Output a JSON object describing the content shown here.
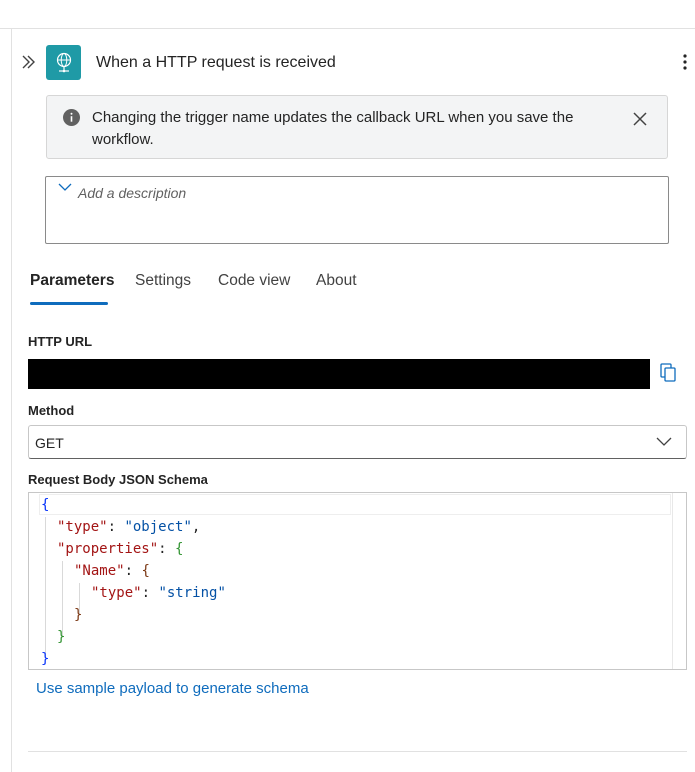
{
  "header": {
    "title": "When a HTTP request is received",
    "icon": "globe-network-icon",
    "accent_color": "#1f9aa6"
  },
  "info_bar": {
    "message": "Changing the trigger name updates the callback URL when you save the workflow."
  },
  "description": {
    "placeholder": "Add a description"
  },
  "tabs": [
    {
      "label": "Parameters",
      "active": true
    },
    {
      "label": "Settings",
      "active": false
    },
    {
      "label": "Code view",
      "active": false
    },
    {
      "label": "About",
      "active": false
    }
  ],
  "fields": {
    "http_url_label": "HTTP URL",
    "http_url_value": "",
    "method_label": "Method",
    "method_value": "GET",
    "schema_label": "Request Body JSON Schema"
  },
  "schema_code": {
    "open_brace": "{",
    "type_key": "\"type\"",
    "type_value": "\"object\"",
    "properties_key": "\"properties\"",
    "name_key": "\"Name\"",
    "name_type_key": "\"type\"",
    "name_type_value": "\"string\"",
    "close_brace": "}"
  },
  "links": {
    "sample_payload": "Use sample payload to generate schema"
  },
  "colors": {
    "link": "#0f6cbd",
    "tab_active_underline": "#0f6cbd"
  }
}
